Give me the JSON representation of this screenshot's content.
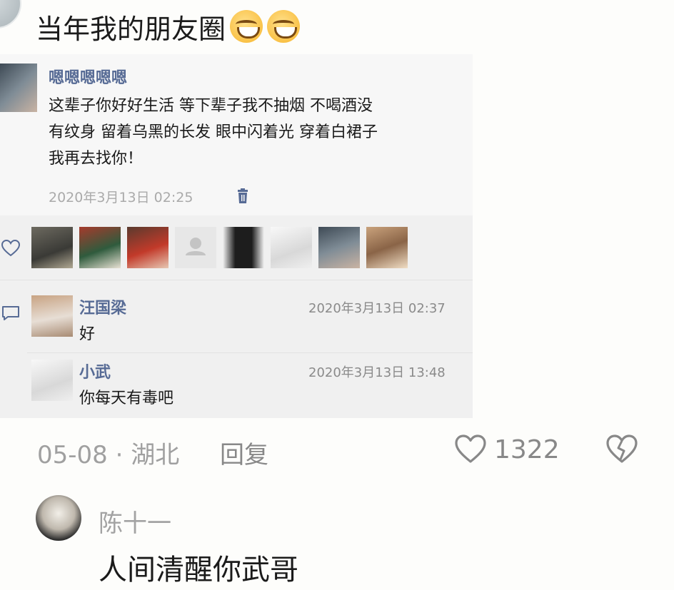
{
  "top_comment": {
    "text": "当年我的朋友圈",
    "emojis": [
      "grinning-face-emoji",
      "grinning-face-emoji"
    ]
  },
  "moment": {
    "author": "嗯嗯嗯嗯嗯",
    "text_lines": [
      "这辈子你好好生活 等下辈子我不抽烟 不喝酒没",
      "有纹身 留着乌黑的长发 眼中闪着光 穿着白裙子",
      "我再去找你！"
    ],
    "time": "2020年3月13日 02:25",
    "delete_icon": "trash-icon",
    "likers_count": 8,
    "comments": [
      {
        "name": "汪国梁",
        "text": "好",
        "time": "2020年3月13日 02:37"
      },
      {
        "name": "小武",
        "text": "你每天有毒吧",
        "time": "2020年3月13日 13:48"
      }
    ]
  },
  "footer": {
    "date_location": "05-08 · 湖北",
    "reply_label": "回复",
    "like_count": "1322",
    "like_icon": "heart-outline-icon",
    "dislike_icon": "broken-heart-icon"
  },
  "reply": {
    "user": "陈十一",
    "text": "人间清醒你武哥"
  },
  "colors": {
    "link_blue": "#576b95",
    "gray_text": "#a0a0a0",
    "card_bg": "#f7f7f7"
  }
}
